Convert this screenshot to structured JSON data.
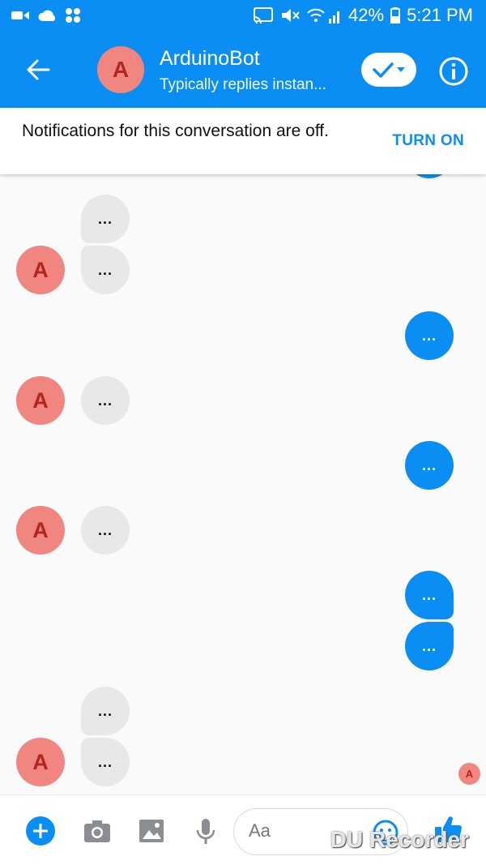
{
  "status_bar": {
    "battery": "42%",
    "time": "5:21 PM"
  },
  "header": {
    "avatar_letter": "A",
    "name": "ArduinoBot",
    "subtitle": "Typically replies instan..."
  },
  "notice": {
    "text": "Notifications for this conversation are off.",
    "action": "TURN ON"
  },
  "messages": {
    "avatar_letter": "A",
    "m1": "...",
    "m2": "...",
    "m3": "...",
    "m4": "...",
    "m5": "...",
    "m6": "...",
    "m7": "...",
    "m8": "...",
    "m9": "...",
    "m10": "...",
    "m11": "..."
  },
  "seen_letter": "A",
  "composer": {
    "placeholder": "Aa"
  },
  "watermark": "DU Recorder",
  "colors": {
    "brand": "#0b8ef3",
    "avatar": "#f0867f",
    "incoming": "#e8e8eb"
  }
}
